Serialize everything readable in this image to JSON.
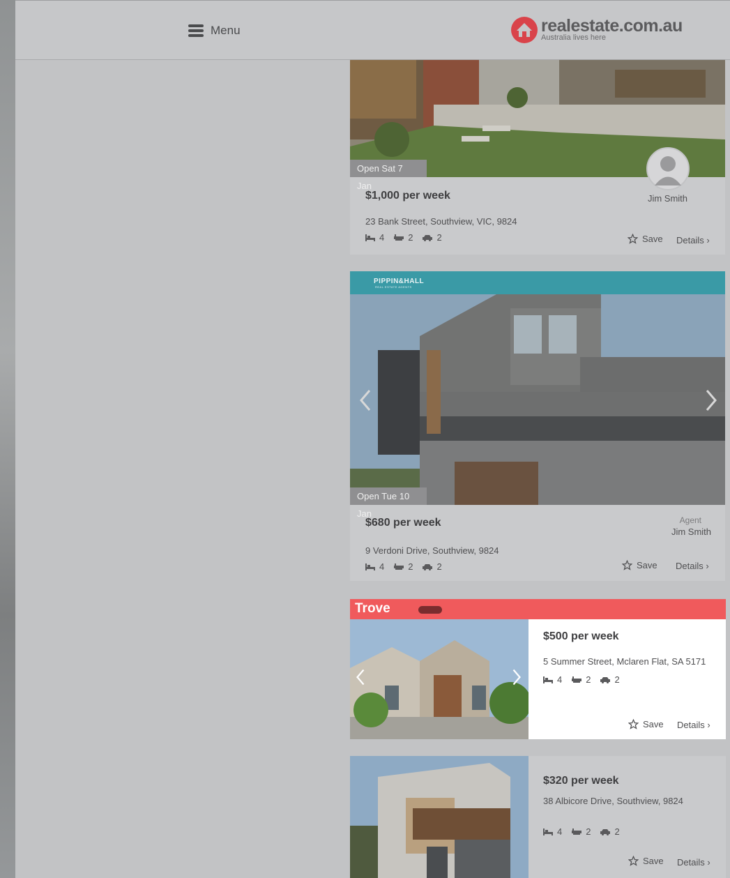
{
  "header": {
    "menu_label": "Menu",
    "logo_main": "realestate.com.au",
    "logo_tagline": "Australia lives here"
  },
  "listings": [
    {
      "open": "Open Sat 7 Jan",
      "price": "$1,000 per week",
      "address": "23 Bank Street, Southview, VIC, 9824",
      "beds": "4",
      "baths": "2",
      "cars": "2",
      "agent_name": "Jim Smith",
      "save": "Save",
      "details": "Details"
    },
    {
      "brand": "PIPPIN&HALL",
      "brand_sub": "REAL ESTATE AGENTS",
      "brand_color": "#3a9aa6",
      "open": "Open Tue 10 Jan",
      "price": "$680 per week",
      "address": "9 Verdoni Drive, Southview, 9824",
      "beds": "4",
      "baths": "2",
      "cars": "2",
      "agent_label": "Agent",
      "agent_name": "Jim Smith",
      "save": "Save",
      "details": "Details"
    },
    {
      "brand": "Trove",
      "brand_color": "#f05a5c",
      "price": "$500 per week",
      "address": "5 Summer Street, Mclaren Flat, SA 5171",
      "beds": "4",
      "baths": "2",
      "cars": "2",
      "save": "Save",
      "details": "Details"
    },
    {
      "price": "$320 per week",
      "address": "38 Albicore Drive, Southview, 9824",
      "beds": "4",
      "baths": "2",
      "cars": "2",
      "save": "Save",
      "details": "Details"
    }
  ],
  "icons": [
    "hamburger-icon",
    "house-logo-icon",
    "bed-icon",
    "bath-icon",
    "car-icon",
    "star-icon",
    "chevron-right-icon",
    "chevron-left-icon",
    "avatar-icon"
  ]
}
